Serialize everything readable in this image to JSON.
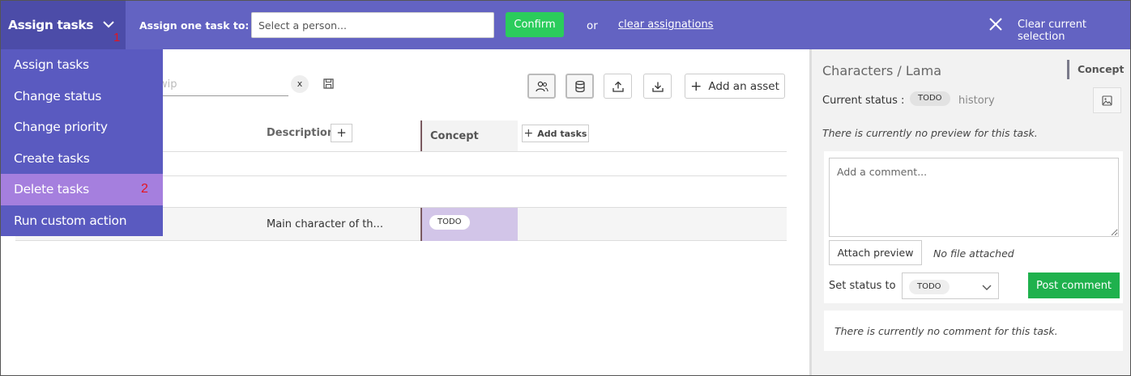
{
  "topbar": {
    "action_label": "Assign tasks",
    "action_marker": "1",
    "assign_label": "Assign one task to:",
    "person_placeholder": "Select a person...",
    "confirm_label": "Confirm",
    "or_text": "or",
    "clear_assignations": "clear assignations",
    "clear_selection": "Clear current selection",
    "accent_color": "#6363c2"
  },
  "dropdown": {
    "items": [
      {
        "label": "Assign tasks",
        "marker": ""
      },
      {
        "label": "Change status",
        "marker": ""
      },
      {
        "label": "Change priority",
        "marker": ""
      },
      {
        "label": "Create tasks",
        "marker": ""
      },
      {
        "label": "Delete tasks",
        "marker": "2"
      },
      {
        "label": "Run custom action",
        "marker": ""
      }
    ],
    "highlight_color": "#a57fde"
  },
  "main": {
    "search_placeholder": "wip",
    "clear_search": "x",
    "add_asset_label": "Add an asset",
    "columns": {
      "description": "Description",
      "task_type": "Concept",
      "add_tasks": "Add tasks"
    },
    "rows": [
      {
        "description": "Main character of th...",
        "concept_status": "TODO"
      }
    ]
  },
  "panel": {
    "title": "Characters / Lama",
    "task_type": "Concept",
    "current_status_label": "Current status :",
    "current_status": "TODO",
    "history_label": "history",
    "no_preview": "There is currently no preview for this task.",
    "comment_placeholder": "Add a comment...",
    "attach_preview": "Attach preview",
    "no_file": "No file attached",
    "set_status_label": "Set status to",
    "set_status_value": "TODO",
    "post_comment": "Post comment",
    "no_comment": "There is currently no comment for this task."
  }
}
